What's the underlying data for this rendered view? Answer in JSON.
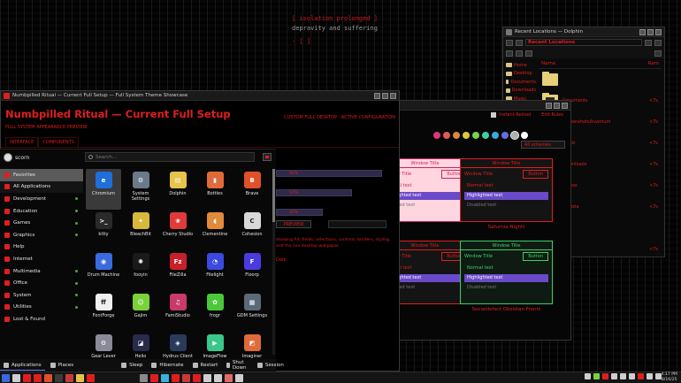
{
  "terminal": {
    "line1": "[ isolation prolonged ]",
    "line2": "depravity and suffering",
    "line3": "- [ ]"
  },
  "dolphin": {
    "title": "Recent Locations — Dolphin",
    "breadcrumb": "Recent Locations",
    "header_left": "Name",
    "header_right": "Ram",
    "sidebar": [
      "Home",
      "Desktop",
      "Documents",
      "Downloads",
      "Music",
      "Pictures",
      "Videos",
      "Trash"
    ],
    "rows": [
      {
        "name": "",
        "count": ""
      },
      {
        "name": "Documents",
        "count": "<7s"
      },
      {
        "name": "Screenshots/kvantum",
        "count": "<7s"
      },
      {
        "name": "music",
        "count": "<7s"
      },
      {
        "name": "Downloads",
        "count": "<7s"
      },
      {
        "name": "Videos",
        "count": "<7s"
      },
      {
        "name": "yuzzzia",
        "count": "<7s"
      },
      {
        "name": "",
        "count": ""
      },
      {
        "name": "Wiz",
        "count": "<7s"
      }
    ]
  },
  "themes": {
    "header": "Instant Reload",
    "header2": "Edit Rules",
    "scheme_select": "All schemes",
    "swatch_colors": [
      "#e0347a",
      "#e05a5a",
      "#e0853a",
      "#d8c83a",
      "#7bd24a",
      "#3ad2a0",
      "#3aa8e0",
      "#6a6ae0",
      "#b0b0b0",
      "#ffffff"
    ],
    "previews": [
      {
        "title": "Window Title",
        "caption": "",
        "bg": "#ffd6e0",
        "fg": "#d02060"
      },
      {
        "title": "Window Title",
        "caption": "Saturnia Nightt",
        "bg": "#141414",
        "fg": "#e01e1e"
      },
      {
        "title": "Window Title",
        "caption": "",
        "bg": "#141414",
        "fg": "#e01e1e"
      },
      {
        "title": "Window Title",
        "caption": "Socialdefect Obsidian Fronts",
        "bg": "#0f1a12",
        "fg": "#3ad26a"
      }
    ],
    "btn_label": "Button",
    "normal_text": "Normal text",
    "highlight_text": "Highlighted text",
    "disabled_text": "Disabled text",
    "link": "link",
    "visited": "visited",
    "caption_left2": "Numbpilled Ritual"
  },
  "mainwin": {
    "title_bar": "Numbpilled Ritual — Current Full Setup — Full System Theme Showcase",
    "title": "Numbpilled Ritual — Current Full Setup",
    "subtitle": "FULL SYSTEM APPEARANCE PREVIEW",
    "right_label": "CUSTOM FULL DESKTOP · ACTIVE CONFIGURATION",
    "tabs": [
      "INTERFACE",
      "COMPONENTS"
    ],
    "progress": [
      {
        "label": "80%",
        "value": 0.8
      },
      {
        "label": "57%",
        "value": 0.57
      },
      {
        "label": "35%",
        "value": 0.35
      }
    ],
    "preview_btn": "PREVIEW",
    "description": "showing Alt: fields, selections, controls, borders, styling, and the live desktop wallpaper.",
    "dark_label": "Dark"
  },
  "launcher": {
    "user": "scorn",
    "search_placeholder": "Search...",
    "categories": [
      {
        "label": "Favorites",
        "selected": true
      },
      {
        "label": "All Applications",
        "selected": false
      },
      {
        "label": "Development",
        "dot": true
      },
      {
        "label": "Education",
        "dot": true
      },
      {
        "label": "Games",
        "dot": true
      },
      {
        "label": "Graphics",
        "dot": true
      },
      {
        "label": "Help"
      },
      {
        "label": "Internet"
      },
      {
        "label": "Multimedia",
        "dot": true
      },
      {
        "label": "Office",
        "dot": true
      },
      {
        "label": "System",
        "dot": true
      },
      {
        "label": "Utilities",
        "dot": true
      },
      {
        "label": "Lost & Found"
      }
    ],
    "apps": [
      {
        "label": "Chromium",
        "color": "#1e6fd9",
        "glyph": "e",
        "selected": true
      },
      {
        "label": "System Settings",
        "color": "#6a7a8a",
        "glyph": "⚙"
      },
      {
        "label": "Dolphin",
        "color": "#e6c34a",
        "glyph": "▤"
      },
      {
        "label": "Bottles",
        "color": "#e06a3a",
        "glyph": "▮"
      },
      {
        "label": "Brave",
        "color": "#e0502a",
        "glyph": "B"
      },
      {
        "label": "kitty",
        "color": "#2a2a2a",
        "glyph": ">_"
      },
      {
        "label": "BleachBit",
        "color": "#d8b83a",
        "glyph": "✦"
      },
      {
        "label": "Cherry Studio",
        "color": "#e03a3a",
        "glyph": "❀"
      },
      {
        "label": "Clementine",
        "color": "#e08a3a",
        "glyph": "◖"
      },
      {
        "label": "Cohesion",
        "color": "#d8d8d8",
        "glyph": "C"
      },
      {
        "label": "Drum Machine",
        "color": "#3a6ae0",
        "glyph": "◉"
      },
      {
        "label": "fooyin",
        "color": "#1a1a1a",
        "glyph": "✺"
      },
      {
        "label": "FileZilla",
        "color": "#c8202a",
        "glyph": "Fz"
      },
      {
        "label": "Filelight",
        "color": "#3a4ae0",
        "glyph": "◔"
      },
      {
        "label": "Floorp",
        "color": "#4a3ae0",
        "glyph": "F"
      },
      {
        "label": "FontForge",
        "color": "#f0f0f0",
        "glyph": "ff"
      },
      {
        "label": "Gajim",
        "color": "#7ad23a",
        "glyph": "☺"
      },
      {
        "label": "FamiStudio",
        "color": "#c83a6a",
        "glyph": "♫"
      },
      {
        "label": "frogr",
        "color": "#4ac83a",
        "glyph": "✿"
      },
      {
        "label": "GDM Settings",
        "color": "#5a6a7a",
        "glyph": "▦"
      },
      {
        "label": "Gear Lever",
        "color": "#8a8a9a",
        "glyph": "⚙"
      },
      {
        "label": "Helio",
        "color": "#2a2a4a",
        "glyph": "◪"
      },
      {
        "label": "Hydrus Client",
        "color": "#2a3a5a",
        "glyph": "◈"
      },
      {
        "label": "ImageFlow",
        "color": "#3ac88a",
        "glyph": "▶"
      },
      {
        "label": "Imaginer",
        "color": "#e06a3a",
        "glyph": "◩"
      }
    ],
    "footer": [
      {
        "label": "Applications",
        "active": true
      },
      {
        "label": "Places"
      },
      {
        "label": "Sleep"
      },
      {
        "label": "Hibernate"
      },
      {
        "label": "Restart"
      },
      {
        "label": "Shut Down"
      },
      {
        "label": "Session"
      }
    ]
  },
  "taskbar": {
    "icons": [
      "#3a6ae0",
      "#cfcfcf",
      "#e01e1e",
      "#e01e1e",
      "#e0502a",
      "#3a3a3a",
      "#c83a3a",
      "#e6c34a",
      "#e01e1e",
      "#8a8a8a",
      "#e01e1e",
      "#3ab0e0",
      "#e01e1e",
      "#c83a3a",
      "#e01e1e",
      "#cfcfcf",
      "#cfcfcf",
      "#e06a6a",
      "#cfcfcf"
    ],
    "tray_icons": [
      "#cfcfcf",
      "#7ad23a",
      "#e01e1e",
      "#cfcfcf",
      "#cfcfcf",
      "#cfcfcf",
      "#e01e1e",
      "#cfcfcf",
      "#cfcfcf"
    ],
    "time": "4:17 PM",
    "date": "8/16/25"
  }
}
